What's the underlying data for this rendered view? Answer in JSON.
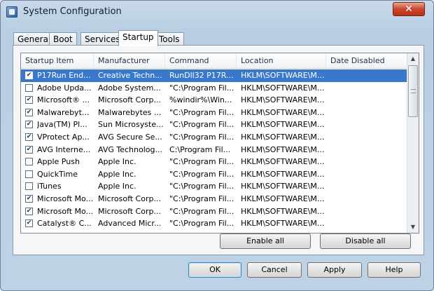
{
  "window": {
    "title": "System Configuration",
    "close_glyph": "✕"
  },
  "tabs": [
    "General",
    "Boot",
    "Services",
    "Startup",
    "Tools"
  ],
  "active_tab": "Startup",
  "columns": [
    "Startup Item",
    "Manufacturer",
    "Command",
    "Location",
    "Date Disabled"
  ],
  "rows": [
    {
      "checked": true,
      "item": "P17Run End...",
      "manufacturer": "Creative Techn...",
      "command": "RunDll32 P17R...",
      "location": "HKLM\\SOFTWARE\\M...",
      "date_disabled": "",
      "selected": true
    },
    {
      "checked": false,
      "item": "Adobe Upda...",
      "manufacturer": "Adobe System...",
      "command": "\"C:\\Program Fil...",
      "location": "HKLM\\SOFTWARE\\M...",
      "date_disabled": ""
    },
    {
      "checked": true,
      "item": "Microsoft® ...",
      "manufacturer": "Microsoft Corp...",
      "command": "%windir%\\Win...",
      "location": "HKLM\\SOFTWARE\\M...",
      "date_disabled": ""
    },
    {
      "checked": true,
      "item": "Malwarebyt...",
      "manufacturer": "Malwarebytes ...",
      "command": "\"C:\\Program Fil...",
      "location": "HKLM\\SOFTWARE\\M...",
      "date_disabled": ""
    },
    {
      "checked": true,
      "item": "Java(TM) Pl...",
      "manufacturer": "Sun Microsyste...",
      "command": "\"C:\\Program Fil...",
      "location": "HKLM\\SOFTWARE\\M...",
      "date_disabled": ""
    },
    {
      "checked": true,
      "item": "VProtect Ap...",
      "manufacturer": "AVG Secure Se...",
      "command": "\"C:\\Program Fil...",
      "location": "HKLM\\SOFTWARE\\M...",
      "date_disabled": ""
    },
    {
      "checked": true,
      "item": "AVG Interne...",
      "manufacturer": "AVG Technolog...",
      "command": "C:\\Program Fil...",
      "location": "HKLM\\SOFTWARE\\M...",
      "date_disabled": ""
    },
    {
      "checked": false,
      "item": "Apple Push",
      "manufacturer": "Apple Inc.",
      "command": "\"C:\\Program Fil...",
      "location": "HKLM\\SOFTWARE\\M...",
      "date_disabled": ""
    },
    {
      "checked": false,
      "item": "QuickTime",
      "manufacturer": "Apple Inc.",
      "command": "\"C:\\Program Fil...",
      "location": "HKLM\\SOFTWARE\\M...",
      "date_disabled": ""
    },
    {
      "checked": false,
      "item": "iTunes",
      "manufacturer": "Apple Inc.",
      "command": "\"C:\\Program Fil...",
      "location": "HKLM\\SOFTWARE\\M...",
      "date_disabled": ""
    },
    {
      "checked": true,
      "item": "Microsoft Mo...",
      "manufacturer": "Microsoft Corp...",
      "command": "\"C:\\Program Fil...",
      "location": "HKLM\\SOFTWARE\\M...",
      "date_disabled": ""
    },
    {
      "checked": true,
      "item": "Microsoft Mo...",
      "manufacturer": "Microsoft Corp...",
      "command": "\"C:\\Program Fil...",
      "location": "HKLM\\SOFTWARE\\M...",
      "date_disabled": ""
    },
    {
      "checked": true,
      "item": "Catalyst® C...",
      "manufacturer": "Advanced Micr...",
      "command": "\"C:\\Program Fil...",
      "location": "HKLM\\SOFTWARE\\M...",
      "date_disabled": ""
    }
  ],
  "panel_buttons": {
    "enable_all": "Enable all",
    "disable_all": "Disable all"
  },
  "footer_buttons": {
    "ok": "OK",
    "cancel": "Cancel",
    "apply": "Apply",
    "help": "Help"
  },
  "icons": {
    "check": "✔",
    "scroll_up": "▲",
    "scroll_down": "▼"
  },
  "colors": {
    "selection": "#3a79c9",
    "close_button": "#c9452b"
  }
}
